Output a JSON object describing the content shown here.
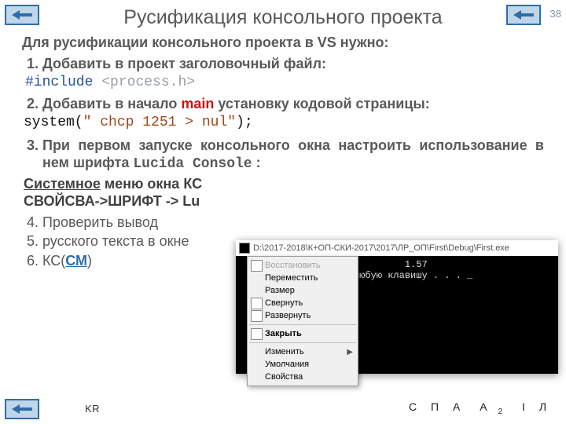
{
  "page_number": "38",
  "title": "Русификация консольного проекта",
  "lead": "Для русификации консольного проекта в VS нужно:",
  "steps": {
    "s1": "Добавить в проект заголовочный файл:",
    "include_kw": "#include",
    "include_hdr": "<process.h>",
    "s2_a": "Добавить в начало ",
    "s2_main": "main",
    "s2_b": " установку кодовой страницы:",
    "sys_a": "system(",
    "sys_str": "\" chcp 1251 > nul\"",
    "sys_b": ");",
    "s3_a": "При первом запуске консольного окна настроить использование в нем шрифта ",
    "s3_font": "Lucida Console",
    "s3_colon": " :",
    "menu_line1_a": "Системное",
    "menu_line1_b": " меню окна КС",
    "menu_line2": "СВОЙСВА->ШРИФТ -> Lu",
    "s4": "Проверить вывод",
    "s5": "русского текста в окне",
    "s6_a": "КС(",
    "s6_cm": "СМ",
    "s6_b": ")"
  },
  "footer": {
    "kr": "KR",
    "letters": [
      "С",
      "П",
      "А",
      "А",
      "I",
      "Л"
    ]
  },
  "console": {
    "title_path": "D:\\2017-2018\\К+ОП-СКИ-2017\\2017\\ЛР_ОП\\First\\Debug\\First.exe",
    "line1": "                             1.57",
    "line2": "               мите любую клавишу . . . _",
    "menu": {
      "restore": "Восстановить",
      "move": "Переместить",
      "size": "Размер",
      "minimize": "Свернуть",
      "maximize": "Развернуть",
      "close": "Закрыть",
      "edit": "Изменить",
      "defaults": "Умолчания",
      "props": "Свойства"
    }
  }
}
